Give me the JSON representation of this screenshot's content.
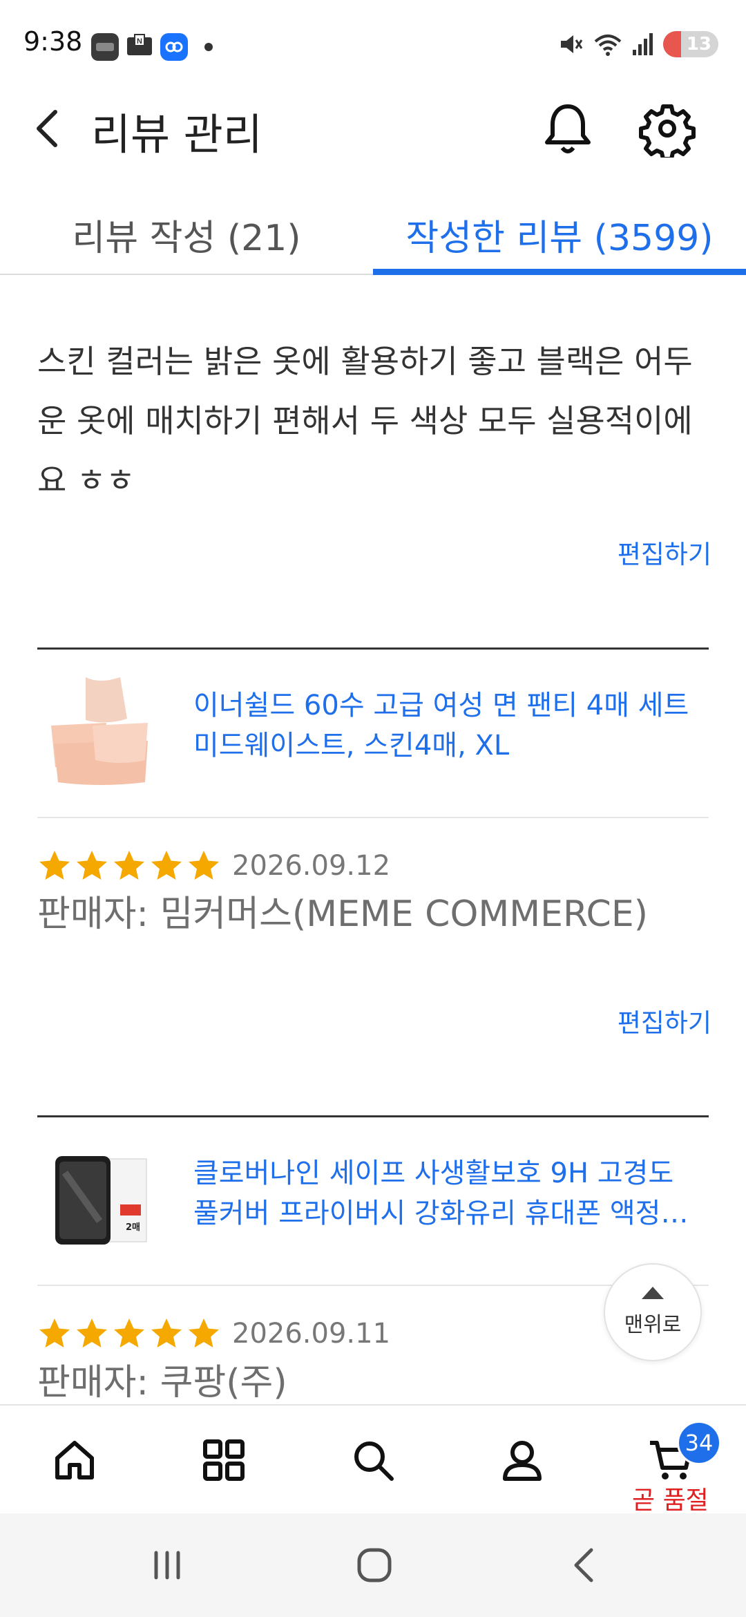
{
  "status_bar": {
    "time": "9:38",
    "battery": "13",
    "app_icons": [
      "samsung-lounge-icon",
      "naver-mail-icon",
      "link-app-icon"
    ]
  },
  "header": {
    "title": "리뷰 관리"
  },
  "tabs": [
    {
      "label": "리뷰 작성 (21)",
      "active": false
    },
    {
      "label": "작성한 리뷰 (3599)",
      "active": true
    }
  ],
  "reviews": [
    {
      "text": "스킨 컬러는 밝은 옷에 활용하기 좋고 블랙은 어두운 옷에 매치하기 편해서 두 색상 모두 실용적이에요  ㅎㅎ",
      "edit_label": "편집하기"
    },
    {
      "product_line1": "이너쉴드 60수 고급 여성 면 팬티 4매 세트",
      "product_line2": "미드웨이스트, 스킨4매, XL",
      "rating": 5,
      "date": "2026.09.12",
      "seller": "판매자: 밈커머스(MEME COMMERCE)",
      "edit_label": "편집하기"
    },
    {
      "product_line1": "클로버나인 세이프 사생활보호 9H 고경도",
      "product_line2": "풀커버 프라이버시 강화유리 휴대폰 액정보...",
      "thumb_label": "2매",
      "rating": 5,
      "date": "2026.09.11",
      "seller": "판매자: 쿠팡(주)"
    }
  ],
  "top_button_label": "맨위로",
  "bottom_nav": {
    "cart_count": "34",
    "cart_status": "곧 품절",
    "items": [
      "home-icon",
      "categories-icon",
      "search-icon",
      "my-page-icon",
      "cart-icon"
    ]
  },
  "colors": {
    "accent": "#1f6feb",
    "star": "#f5a800",
    "soldout": "#e02020"
  }
}
